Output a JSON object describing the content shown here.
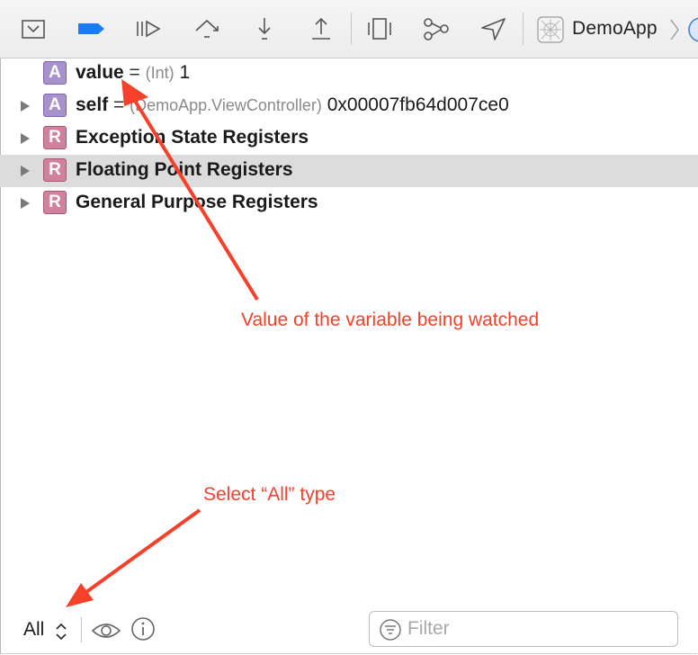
{
  "toolbar": {
    "buttons": [
      {
        "name": "hide-debug-area-button",
        "icon": "panel-toggle-icon"
      },
      {
        "name": "breakpoints-toggle-button",
        "icon": "breakpoint-icon"
      },
      {
        "name": "continue-button",
        "icon": "continue-icon"
      },
      {
        "name": "step-over-button",
        "icon": "step-over-icon"
      },
      {
        "name": "step-into-button",
        "icon": "step-into-icon"
      },
      {
        "name": "step-out-button",
        "icon": "step-out-icon"
      },
      {
        "name": "debug-view-hierarchy-button",
        "icon": "view-hierarchy-icon"
      },
      {
        "name": "debug-memory-graph-button",
        "icon": "memory-graph-icon"
      },
      {
        "name": "simulate-location-button",
        "icon": "location-icon"
      }
    ],
    "accent_color": "#1a7cf5",
    "scheme_label": "DemoApp"
  },
  "variables": {
    "value": {
      "name": "value",
      "equals": "=",
      "type": "(Int)",
      "value": "1",
      "badge": "A"
    },
    "self": {
      "name": "self",
      "equals": "=",
      "type": "(DemoApp.ViewController)",
      "value": "0x00007fb64d007ce0",
      "badge": "A"
    },
    "registers": [
      {
        "badge": "R",
        "label": "Exception State Registers"
      },
      {
        "badge": "R",
        "label": "Floating Point Registers"
      },
      {
        "badge": "R",
        "label": "General Purpose Registers"
      }
    ]
  },
  "annotations": {
    "watched": "Value of the variable being watched",
    "select_all": "Select “All” type",
    "color": "#f5402a"
  },
  "footer": {
    "scope": "All",
    "filter_placeholder": "Filter"
  }
}
